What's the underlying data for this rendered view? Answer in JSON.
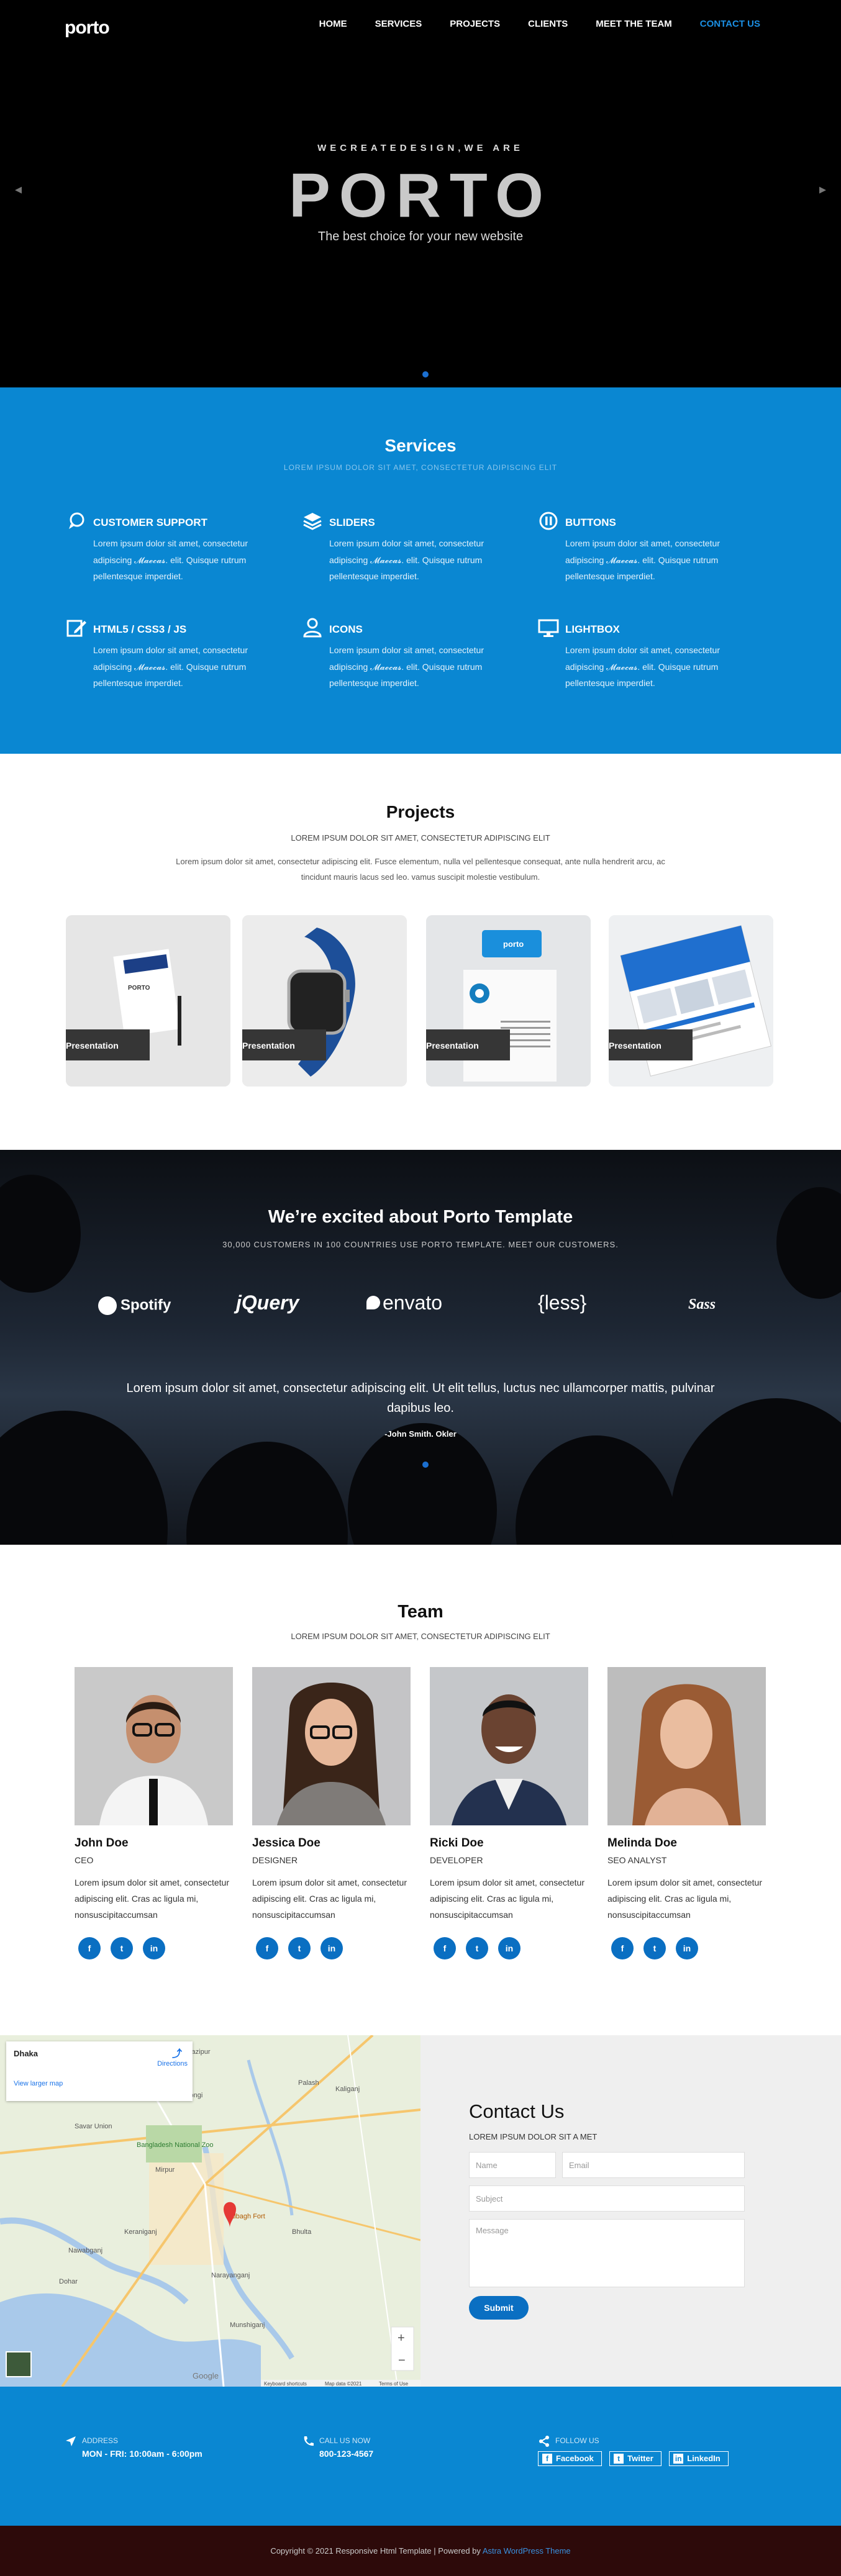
{
  "header": {
    "logo": "porto",
    "nav": [
      "HOME",
      "SERVICES",
      "PROJECTS",
      "CLIENTS",
      "MEET THE TEAM",
      "CONTACT US"
    ],
    "active_nav": "CONTACT US"
  },
  "hero": {
    "kicker": "WECREATEDESIGN,WE ARE",
    "title": "PORTO",
    "subtitle": "The best choice for your new website"
  },
  "services": {
    "title": "Services",
    "subtitle": "LOREM IPSUM DOLOR SIT AMET, CONSECTETUR ADIPISCING ELIT",
    "items": [
      {
        "title": "CUSTOMER SUPPORT",
        "icon": "chat-bubble-icon",
        "text": "Lorem ipsum dolor sit amet, consectetur adipiscing 𝓜𝓪𝓮𝓬𝓪𝓼. elit. Quisque rutrum pellentesque imperdiet."
      },
      {
        "title": "SLIDERS",
        "icon": "layers-icon",
        "text": "Lorem ipsum dolor sit amet, consectetur adipiscing 𝓜𝓪𝓮𝓬𝓪𝓼. elit. Quisque rutrum pellentesque imperdiet."
      },
      {
        "title": "BUTTONS",
        "icon": "pause-circle-icon",
        "text": "Lorem ipsum dolor sit amet, consectetur adipiscing 𝓜𝓪𝓮𝓬𝓪𝓼. elit. Quisque rutrum pellentesque imperdiet."
      },
      {
        "title": "HTML5 / CSS3 / JS",
        "icon": "edit-document-icon",
        "text": "Lorem ipsum dolor sit amet, consectetur adipiscing 𝓜𝓪𝓮𝓬𝓪𝓼. elit. Quisque rutrum pellentesque imperdiet."
      },
      {
        "title": "ICONS",
        "icon": "user-icon",
        "text": "Lorem ipsum dolor sit amet, consectetur adipiscing 𝓜𝓪𝓮𝓬𝓪𝓼. elit. Quisque rutrum pellentesque imperdiet."
      },
      {
        "title": "LIGHTBOX",
        "icon": "monitor-icon",
        "text": "Lorem ipsum dolor sit amet, consectetur adipiscing 𝓜𝓪𝓮𝓬𝓪𝓼. elit. Quisque rutrum pellentesque imperdiet."
      }
    ]
  },
  "projects": {
    "title": "Projects",
    "subtitle": "LOREM IPSUM DOLOR SIT AMET, CONSECTETUR ADIPISCING ELIT",
    "description": "Lorem ipsum dolor sit amet, consectetur adipiscing elit. Fusce elementum, nulla vel pellentesque consequat, ante nulla hendrerit arcu, ac tincidunt mauris lacus sed leo. vamus suscipit molestie vestibulum.",
    "cards": [
      {
        "caption": "Presentation"
      },
      {
        "caption": "Presentation"
      },
      {
        "caption": "Presentation"
      },
      {
        "caption": "Presentation"
      }
    ],
    "card_texts": {
      "stationery_brand": "PORTO",
      "box_brand": "porto"
    }
  },
  "testimonials": {
    "title": "We’re excited about Porto Template",
    "subtitle": "30,000 CUSTOMERS IN 100 COUNTRIES USE PORTO TEMPLATE. MEET OUR CUSTOMERS.",
    "brands": [
      "Spotify",
      "jQuery",
      "envato",
      "{less}",
      "Sass"
    ],
    "quote": "Lorem ipsum dolor sit amet, consectetur adipiscing elit. Ut elit tellus, luctus nec ullamcorper mattis, pulvinar dapibus leo.",
    "author": "-John Smith. Okler"
  },
  "team": {
    "title": "Team",
    "subtitle": "LOREM IPSUM DOLOR SIT AMET, CONSECTETUR ADIPISCING ELIT",
    "members": [
      {
        "name": "John Doe",
        "role": "CEO",
        "bio": "Lorem ipsum dolor sit amet, consectetur adipiscing elit. Cras ac ligula mi, nonsuscipitaccumsan"
      },
      {
        "name": "Jessica Doe",
        "role": "DESIGNER",
        "bio": "Lorem ipsum dolor sit amet, consectetur adipiscing elit. Cras ac ligula mi, nonsuscipitaccumsan"
      },
      {
        "name": "Ricki Doe",
        "role": "DEVELOPER",
        "bio": "Lorem ipsum dolor sit amet, consectetur adipiscing elit. Cras ac ligula mi, nonsuscipitaccumsan"
      },
      {
        "name": "Melinda Doe",
        "role": "SEO ANALYST",
        "bio": "Lorem ipsum dolor sit amet, consectetur adipiscing elit. Cras ac ligula mi, nonsuscipitaccumsan"
      }
    ],
    "social_icons": [
      "facebook-icon",
      "twitter-icon",
      "linkedin-icon"
    ]
  },
  "map": {
    "place": "Dhaka",
    "directions": "Directions",
    "larger_map": "View larger map",
    "labels": [
      "Savar Union",
      "Tongi",
      "Bangladesh National Zoo",
      "Mirpur",
      "Lalbagh Fort",
      "Narayanganj",
      "Munshiganj",
      "Dohar",
      "Keraniganj",
      "Nawabganj",
      "Bhulta",
      "Kaliganj",
      "Palash",
      "Gazipur"
    ],
    "footer": [
      "Keyboard shortcuts",
      "Map data ©2021",
      "Terms of Use"
    ],
    "brand": "Google"
  },
  "contact": {
    "title": "Contact Us",
    "subtitle": "LOREM IPSUM DOLOR SIT A MET",
    "fields": {
      "name": "Name",
      "email": "Email",
      "subject": "Subject",
      "message": "Message"
    },
    "submit": "Submit"
  },
  "footer": {
    "address_label": "ADDRESS",
    "address_value": "MON - FRI: 10:00am - 6:00pm",
    "call_label": "CALL US NOW",
    "call_value": "800-123-4567",
    "follow_label": "FOLLOW US",
    "follow_links": [
      "Facebook",
      "Twitter",
      "LinkedIn"
    ],
    "copyright": "Copyright © 2021 Responsive Html Template | Powered by ",
    "powered_link": "Astra WordPress Theme"
  },
  "colors": {
    "primary": "#0a87d2",
    "accent_link": "#1b8fe3",
    "dark": "#000000",
    "copyright_bg": "#2d0a0a"
  }
}
